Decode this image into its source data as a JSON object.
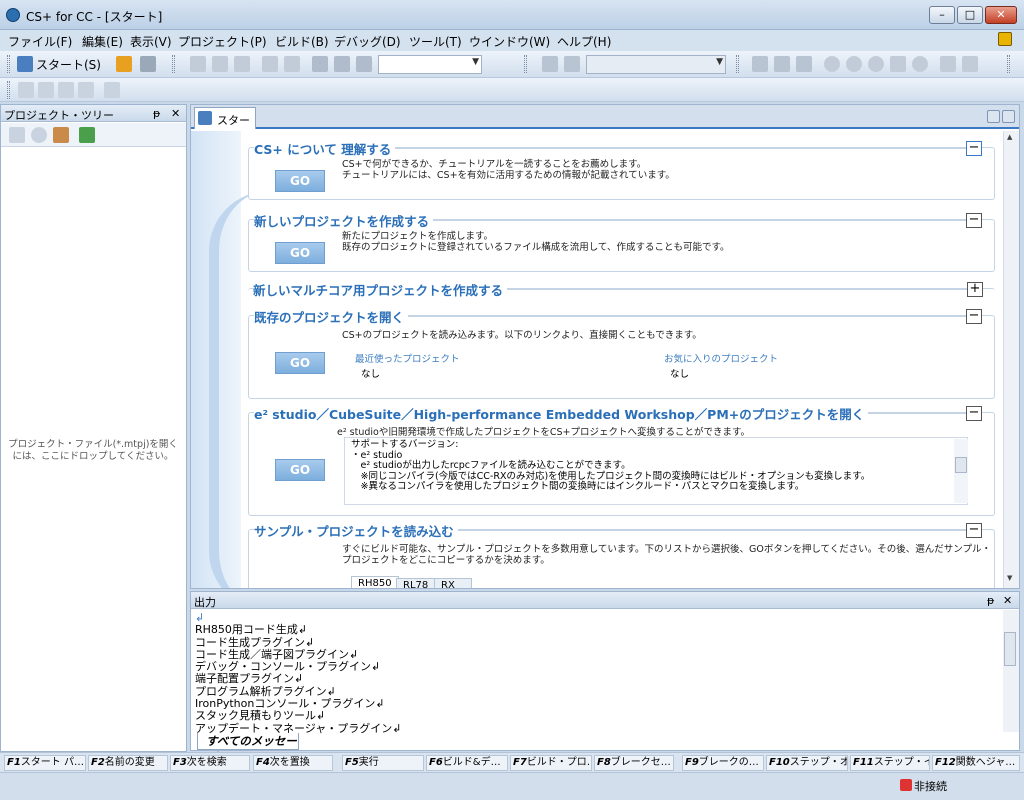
{
  "window": {
    "title": "CS+ for CC - [スタート]",
    "minimize": "–",
    "maximize": "□",
    "close": "✕"
  },
  "menu": [
    "ファイル(F)",
    "編集(E)",
    "表示(V)",
    "プロジェクト(P)",
    "ビルド(B)",
    "デバッグ(D)",
    "ツール(T)",
    "ウインドウ(W)",
    "ヘルプ(H)"
  ],
  "toolbar": {
    "start_label": "スタート(S)"
  },
  "tree": {
    "title": "プロジェクト・ツリー",
    "pin": "ᵽ",
    "close": "✕",
    "drop_hint": "プロジェクト・ファイル(*.mtpj)を開くには、ここにドロップしてください。"
  },
  "tab": {
    "label": "スタート"
  },
  "sections": {
    "about": {
      "title": "CS+ について 理解する",
      "toggle": "−",
      "go": "GO",
      "text1": "CS+で何ができるか、チュートリアルを一読することをお薦めします。",
      "text2": "チュートリアルには、CS+を有効に活用するための情報が記載されています。"
    },
    "new_project": {
      "title": "新しいプロジェクトを作成する",
      "toggle": "−",
      "go": "GO",
      "text1": "新たにプロジェクトを作成します。",
      "text2": "既存のプロジェクトに登録されているファイル構成を流用して、作成することも可能です。"
    },
    "multicore": {
      "title": "新しいマルチコア用プロジェクトを作成する",
      "toggle": "+"
    },
    "open_existing": {
      "title": "既存のプロジェクトを開く",
      "toggle": "−",
      "go": "GO",
      "text1": "CS+のプロジェクトを読み込みます。以下のリンクより、直接開くこともできます。",
      "recent_label": "最近使ったプロジェクト",
      "recent_value": "なし",
      "favorite_label": "お気に入りのプロジェクト",
      "favorite_value": "なし"
    },
    "e2studio": {
      "title": "e² studio／CubeSuite／High-performance Embedded Workshop／PM+のプロジェクトを開く",
      "toggle": "−",
      "go": "GO",
      "text1": "e² studioや旧開発環境で作成したプロジェクトをCS+プロジェクトへ変換することができます。",
      "versions": [
        "サポートするバージョン:",
        "・e² studio",
        "　e² studioが出力したrcpcファイルを読み込むことができます。",
        "　※同じコンパイラ(今版ではCC-RXのみ対応)を使用したプロジェクト間の変換時にはビルド・オプションも変換します。",
        "　※異なるコンパイラを使用したプロジェクト間の変換時にはインクルード・パスとマクロを変換します。"
      ]
    },
    "sample": {
      "title": "サンプル・プロジェクトを読み込む",
      "toggle": "−",
      "text1": "すぐにビルド可能な、サンプル・プロジェクトを多数用意しています。下のリストから選択後、GOボタンを押してください。その後、選んだサンプル・",
      "text2": "プロジェクトをどこにコピーするかを決めます。",
      "tabs": [
        "RH850",
        "RL78",
        "RX"
      ]
    }
  },
  "output": {
    "title": "出力",
    "pin": "ᵽ",
    "close": "✕",
    "lines": [
      "↲",
      "RH850用コード生成↲",
      "コード生成プラグイン↲",
      "コード生成／端子図プラグイン↲",
      "デバッグ・コンソール・プラグイン↲",
      "端子配置プラグイン↲",
      "プログラム解析プラグイン↲",
      "IronPythonコンソール・プラグイン↲",
      "スタック見積もりツール↲",
      "アップデート・マネージャ・プラグイン↲",
      "↲"
    ],
    "tab": "すべてのメッセージ"
  },
  "fkeys": [
    {
      "key": "F1",
      "label": "スタート パ…"
    },
    {
      "key": "F2",
      "label": "名前の変更"
    },
    {
      "key": "F3",
      "label": "次を検索"
    },
    {
      "key": "F4",
      "label": "次を置換"
    },
    {
      "key": "F5",
      "label": "実行"
    },
    {
      "key": "F6",
      "label": "ビルド&デ…"
    },
    {
      "key": "F7",
      "label": "ビルド・プロ…"
    },
    {
      "key": "F8",
      "label": "ブレークセ…"
    },
    {
      "key": "F9",
      "label": "ブレークの…"
    },
    {
      "key": "F10",
      "label": "ステップ・オ…"
    },
    {
      "key": "F11",
      "label": "ステップ・イン"
    },
    {
      "key": "F12",
      "label": "関数へジャ…"
    }
  ],
  "status": {
    "connection": "非接続"
  }
}
